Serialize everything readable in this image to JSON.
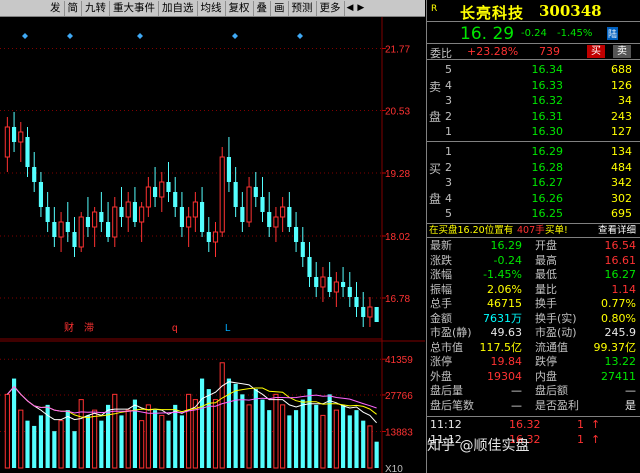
{
  "toolbar": {
    "items": [
      "发",
      "简",
      "九转",
      "重大事件",
      "加自选",
      "均线",
      "复权",
      "叠",
      "画",
      "预测",
      "更多"
    ]
  },
  "stock": {
    "name": "长亮科技",
    "code": "300348",
    "r_label": "R",
    "price": "16. 29",
    "change": "-0.24",
    "change_pct": "-1.45%",
    "tag": "陆"
  },
  "weibi": {
    "label": "委比",
    "pct": "+23.28%",
    "diff": "739",
    "buy_btn": "买",
    "sell_btn": "卖"
  },
  "order_book": {
    "sell_side_label": [
      "卖",
      "盘"
    ],
    "buy_side_label": [
      "买",
      "盘"
    ],
    "asks": [
      {
        "lvl": "5",
        "price": "16.34",
        "vol": "688"
      },
      {
        "lvl": "4",
        "price": "16.33",
        "vol": "126"
      },
      {
        "lvl": "3",
        "price": "16.32",
        "vol": "34"
      },
      {
        "lvl": "2",
        "price": "16.31",
        "vol": "243"
      },
      {
        "lvl": "1",
        "price": "16.30",
        "vol": "127"
      }
    ],
    "bids": [
      {
        "lvl": "1",
        "price": "16.29",
        "vol": "134"
      },
      {
        "lvl": "2",
        "price": "16.28",
        "vol": "484"
      },
      {
        "lvl": "3",
        "price": "16.27",
        "vol": "342"
      },
      {
        "lvl": "4",
        "price": "16.26",
        "vol": "302"
      },
      {
        "lvl": "5",
        "price": "16.25",
        "vol": "695"
      }
    ]
  },
  "bid_info": {
    "text": "在买盘16.20位置有",
    "vol": "407手",
    "action": "买单!",
    "detail": "查看详细"
  },
  "stats": [
    {
      "l1": "最新",
      "v1": "16.29",
      "c1": "green",
      "l2": "开盘",
      "v2": "16.54",
      "c2": "red"
    },
    {
      "l1": "涨跌",
      "v1": "-0.24",
      "c1": "green",
      "l2": "最高",
      "v2": "16.61",
      "c2": "red"
    },
    {
      "l1": "涨幅",
      "v1": "-1.45%",
      "c1": "green",
      "l2": "最低",
      "v2": "16.27",
      "c2": "green"
    },
    {
      "l1": "振幅",
      "v1": "2.06%",
      "c1": "yellow",
      "l2": "量比",
      "v2": "1.14",
      "c2": "red"
    },
    {
      "l1": "总手",
      "v1": "46715",
      "c1": "yellow",
      "l2": "换手",
      "v2": "0.77%",
      "c2": "yellow"
    },
    {
      "l1": "金额",
      "v1": "7631万",
      "c1": "cyan",
      "l2": "换手(实)",
      "v2": "0.80%",
      "c2": "yellow"
    },
    {
      "l1": "市盈(静)",
      "v1": "49.63",
      "c1": "white",
      "l2": "市盈(动)",
      "v2": "245.9",
      "c2": "white"
    },
    {
      "l1": "总市值",
      "v1": "117.5亿",
      "c1": "yellow",
      "l2": "流通值",
      "v2": "99.37亿",
      "c2": "yellow"
    },
    {
      "l1": "涨停",
      "v1": "19.84",
      "c1": "red",
      "l2": "跌停",
      "v2": "13.22",
      "c2": "green"
    },
    {
      "l1": "外盘",
      "v1": "19304",
      "c1": "red",
      "l2": "内盘",
      "v2": "27411",
      "c2": "green"
    },
    {
      "l1": "盘后量",
      "v1": "—",
      "c1": "white",
      "l2": "盘后额",
      "v2": "—",
      "c2": "white"
    },
    {
      "l1": "盘后笔数",
      "v1": "—",
      "c1": "white",
      "l2": "是否盈利",
      "v2": "是",
      "c2": "white"
    }
  ],
  "ticks": [
    {
      "time": "11:12",
      "price": "16.32",
      "vol": "1",
      "dir": "↑"
    },
    {
      "time": "11:12",
      "price": "16.32",
      "vol": "1",
      "dir": "↑"
    }
  ],
  "watermark": "知乎 @顺佳实盘",
  "price_axis": [
    "21.77",
    "20.53",
    "19.28",
    "18.02",
    "16.78"
  ],
  "vol_axis": [
    "41359",
    "27766",
    "13883",
    "X10"
  ],
  "chart_markers": {
    "event_labels": [
      {
        "text": "财",
        "color": "#ff3232"
      },
      {
        "text": "滞",
        "color": "#ff3232"
      },
      {
        "text": "q",
        "color": "#ff3232"
      },
      {
        "text": "L",
        "color": "#00aaff"
      }
    ]
  },
  "chart_data": {
    "type": "candlestick",
    "ylim": [
      16.0,
      22.4
    ],
    "candles": [
      {
        "o": 19.6,
        "h": 20.4,
        "l": 19.3,
        "c": 20.2
      },
      {
        "o": 20.2,
        "h": 20.5,
        "l": 19.7,
        "c": 19.9
      },
      {
        "o": 19.9,
        "h": 20.3,
        "l": 19.5,
        "c": 20.1
      },
      {
        "o": 20.0,
        "h": 20.2,
        "l": 19.2,
        "c": 19.4
      },
      {
        "o": 19.4,
        "h": 19.7,
        "l": 18.9,
        "c": 19.1
      },
      {
        "o": 19.1,
        "h": 19.3,
        "l": 18.4,
        "c": 18.6
      },
      {
        "o": 18.6,
        "h": 18.9,
        "l": 18.1,
        "c": 18.3
      },
      {
        "o": 18.3,
        "h": 18.6,
        "l": 17.8,
        "c": 18.0
      },
      {
        "o": 18.0,
        "h": 18.5,
        "l": 17.7,
        "c": 18.3
      },
      {
        "o": 18.3,
        "h": 18.7,
        "l": 17.9,
        "c": 18.1
      },
      {
        "o": 18.1,
        "h": 18.4,
        "l": 17.6,
        "c": 17.8
      },
      {
        "o": 17.8,
        "h": 18.5,
        "l": 17.7,
        "c": 18.4
      },
      {
        "o": 18.4,
        "h": 18.8,
        "l": 18.0,
        "c": 18.2
      },
      {
        "o": 18.2,
        "h": 18.6,
        "l": 17.8,
        "c": 18.5
      },
      {
        "o": 18.5,
        "h": 18.9,
        "l": 18.1,
        "c": 18.3
      },
      {
        "o": 18.3,
        "h": 18.7,
        "l": 17.9,
        "c": 18.0
      },
      {
        "o": 18.0,
        "h": 18.8,
        "l": 17.8,
        "c": 18.6
      },
      {
        "o": 18.6,
        "h": 19.0,
        "l": 18.2,
        "c": 18.4
      },
      {
        "o": 18.4,
        "h": 18.9,
        "l": 18.1,
        "c": 18.7
      },
      {
        "o": 18.7,
        "h": 19.0,
        "l": 18.2,
        "c": 18.3
      },
      {
        "o": 18.3,
        "h": 18.7,
        "l": 17.9,
        "c": 18.6
      },
      {
        "o": 18.6,
        "h": 19.2,
        "l": 18.4,
        "c": 19.0
      },
      {
        "o": 19.0,
        "h": 19.4,
        "l": 18.6,
        "c": 18.8
      },
      {
        "o": 18.8,
        "h": 19.3,
        "l": 18.5,
        "c": 19.1
      },
      {
        "o": 19.1,
        "h": 19.5,
        "l": 18.7,
        "c": 18.9
      },
      {
        "o": 18.9,
        "h": 19.2,
        "l": 18.4,
        "c": 18.6
      },
      {
        "o": 18.6,
        "h": 18.9,
        "l": 18.0,
        "c": 18.2
      },
      {
        "o": 18.2,
        "h": 18.6,
        "l": 17.8,
        "c": 18.4
      },
      {
        "o": 18.4,
        "h": 18.9,
        "l": 18.1,
        "c": 18.7
      },
      {
        "o": 18.7,
        "h": 19.0,
        "l": 18.0,
        "c": 18.1
      },
      {
        "o": 18.1,
        "h": 18.4,
        "l": 17.7,
        "c": 17.9
      },
      {
        "o": 17.9,
        "h": 18.3,
        "l": 17.6,
        "c": 18.1
      },
      {
        "o": 18.1,
        "h": 19.8,
        "l": 18.0,
        "c": 19.6
      },
      {
        "o": 19.6,
        "h": 20.0,
        "l": 18.9,
        "c": 19.1
      },
      {
        "o": 19.1,
        "h": 19.4,
        "l": 18.4,
        "c": 18.6
      },
      {
        "o": 18.6,
        "h": 18.9,
        "l": 18.1,
        "c": 18.3
      },
      {
        "o": 18.3,
        "h": 19.2,
        "l": 18.2,
        "c": 19.0
      },
      {
        "o": 19.0,
        "h": 19.3,
        "l": 18.6,
        "c": 18.8
      },
      {
        "o": 18.8,
        "h": 19.2,
        "l": 18.3,
        "c": 18.5
      },
      {
        "o": 18.5,
        "h": 18.9,
        "l": 18.0,
        "c": 18.2
      },
      {
        "o": 18.2,
        "h": 18.6,
        "l": 17.9,
        "c": 18.4
      },
      {
        "o": 18.4,
        "h": 18.8,
        "l": 18.1,
        "c": 18.6
      },
      {
        "o": 18.6,
        "h": 18.9,
        "l": 18.1,
        "c": 18.2
      },
      {
        "o": 18.2,
        "h": 18.5,
        "l": 17.7,
        "c": 17.9
      },
      {
        "o": 17.9,
        "h": 18.2,
        "l": 17.4,
        "c": 17.6
      },
      {
        "o": 17.6,
        "h": 17.9,
        "l": 17.0,
        "c": 17.2
      },
      {
        "o": 17.2,
        "h": 17.5,
        "l": 16.8,
        "c": 17.0
      },
      {
        "o": 17.0,
        "h": 17.4,
        "l": 16.7,
        "c": 17.2
      },
      {
        "o": 17.2,
        "h": 17.5,
        "l": 16.8,
        "c": 16.9
      },
      {
        "o": 16.9,
        "h": 17.3,
        "l": 16.6,
        "c": 17.1
      },
      {
        "o": 17.1,
        "h": 17.4,
        "l": 16.8,
        "c": 17.0
      },
      {
        "o": 17.0,
        "h": 17.3,
        "l": 16.6,
        "c": 16.8
      },
      {
        "o": 16.8,
        "h": 17.1,
        "l": 16.4,
        "c": 16.6
      },
      {
        "o": 16.6,
        "h": 16.9,
        "l": 16.2,
        "c": 16.4
      },
      {
        "o": 16.4,
        "h": 16.8,
        "l": 16.2,
        "c": 16.6
      },
      {
        "o": 16.6,
        "h": 16.6,
        "l": 16.3,
        "c": 16.3
      }
    ],
    "volume": [
      28,
      34,
      22,
      18,
      16,
      20,
      24,
      14,
      18,
      22,
      14,
      26,
      20,
      22,
      18,
      24,
      28,
      20,
      22,
      26,
      18,
      24,
      22,
      20,
      18,
      24,
      20,
      28,
      26,
      34,
      30,
      26,
      40,
      34,
      32,
      28,
      24,
      30,
      26,
      22,
      28,
      24,
      20,
      22,
      26,
      30,
      24,
      20,
      28,
      22,
      24,
      20,
      22,
      18,
      16,
      10
    ],
    "vol_max": 41359
  }
}
